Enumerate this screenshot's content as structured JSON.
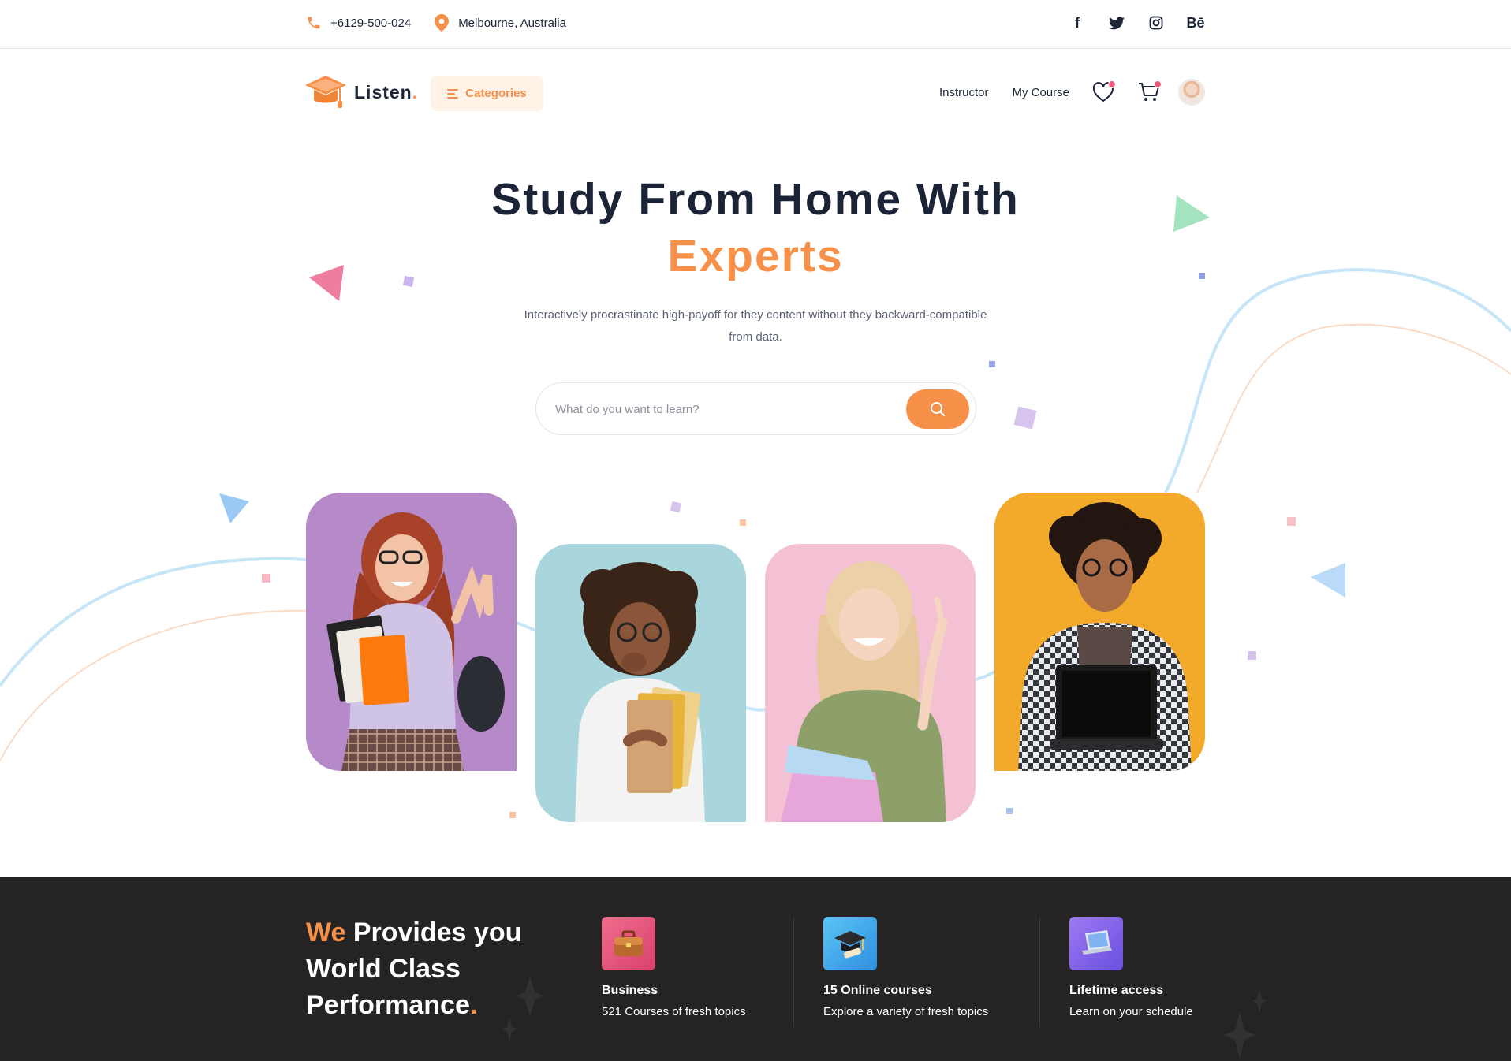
{
  "topbar": {
    "phone": "+6129-500-024",
    "location": "Melbourne, Australia",
    "social": [
      {
        "icon": "facebook-icon",
        "label": "f"
      },
      {
        "icon": "twitter-icon",
        "label": ""
      },
      {
        "icon": "instagram-icon",
        "label": ""
      },
      {
        "icon": "behance-icon",
        "label": "Bē"
      }
    ]
  },
  "nav": {
    "brand": "Listen",
    "brand_dot": ".",
    "categories_label": "Categories",
    "links": [
      "Instructor",
      "My Course"
    ]
  },
  "hero": {
    "title_line1": "Study From Home With",
    "title_line2": "Experts",
    "subtitle": "Interactively procrastinate high-payoff for they content without they  backward-compatible from data.",
    "search_placeholder": "What do you want to learn?"
  },
  "features": {
    "heading_accent": "We",
    "heading_rest": " Provides you World Class Performance",
    "heading_dot": ".",
    "items": [
      {
        "icon": "briefcase-icon",
        "title": "Business",
        "desc": "521 Courses of fresh topics"
      },
      {
        "icon": "graduation-cap-icon",
        "title": "15 Online courses",
        "desc": "Explore a variety of fresh topics"
      },
      {
        "icon": "laptop-icon",
        "title": "Lifetime access",
        "desc": "Learn on your schedule"
      }
    ]
  },
  "colors": {
    "accent": "#f7914a",
    "dark": "#1b2336",
    "band": "#252323"
  }
}
